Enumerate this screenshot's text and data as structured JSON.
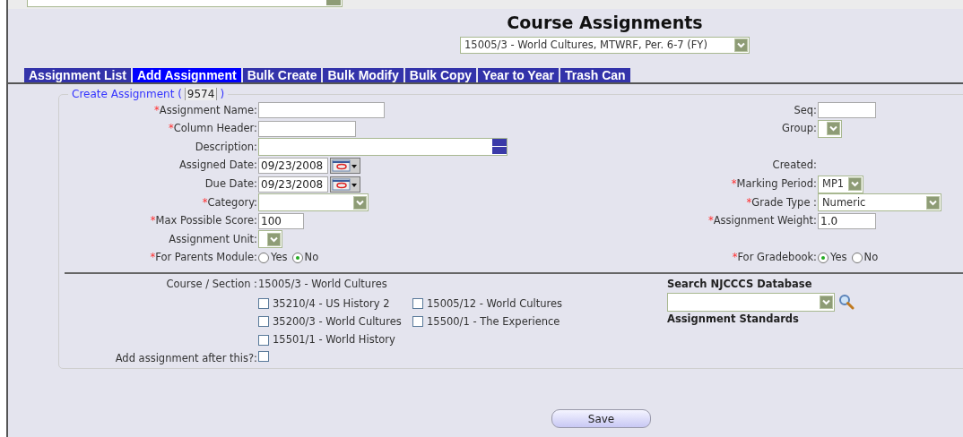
{
  "page_title": "Course Assignments",
  "section_select": {
    "value": "15005/3 - World Cultures, MTWRF, Per. 6-7 (FY)"
  },
  "tabs": [
    {
      "label": "Assignment List",
      "selected": false
    },
    {
      "label": "Add Assignment",
      "selected": true
    },
    {
      "label": "Bulk Create",
      "selected": false
    },
    {
      "label": "Bulk Modify",
      "selected": false
    },
    {
      "label": "Bulk Copy",
      "selected": false
    },
    {
      "label": "Year to Year",
      "selected": false
    },
    {
      "label": "Trash Can",
      "selected": false
    }
  ],
  "form": {
    "legend": "Create Assignment (",
    "id_value": "9574",
    "legend_end": ")",
    "rows": [
      {
        "left": {
          "kind": "text",
          "mark": "*",
          "label": "Assignment Name:"
        },
        "right": {
          "kind": "text",
          "label": "Seq:"
        }
      },
      {
        "left": {
          "kind": "text",
          "mark": "*",
          "label": "Column Header:"
        },
        "right": {
          "kind": "select",
          "label": "Group:"
        }
      },
      {
        "left": {
          "kind": "textarea",
          "label": "Description:"
        }
      },
      {
        "left": {
          "kind": "date",
          "label": "Assigned Date:",
          "value": "09/23/2008"
        },
        "right": {
          "kind": "plain",
          "label": "Created:"
        }
      },
      {
        "left": {
          "kind": "date",
          "label": "Due Date:",
          "value": "09/23/2008"
        },
        "right": {
          "kind": "select",
          "mark": "*",
          "label": "Marking Period:",
          "value": "MP1"
        }
      },
      {
        "left": {
          "kind": "select",
          "mark": "*",
          "label": "Category:"
        },
        "right": {
          "kind": "select",
          "mark": "*",
          "label": "Grade Type :",
          "value": "Numeric"
        }
      },
      {
        "left": {
          "kind": "text",
          "mark": "*",
          "label": "Max Possible Score:",
          "value": "100"
        },
        "right": {
          "kind": "text",
          "mark": "*",
          "label": "Assignment Weight:",
          "value": "1.0"
        }
      },
      {
        "left": {
          "kind": "select",
          "label": "Assignment Unit:"
        }
      },
      {
        "left": {
          "kind": "radio",
          "mark": "*",
          "label": "For Parents Module:",
          "options": [
            {
              "label": "Yes",
              "selected": false
            },
            {
              "label": "No",
              "selected": true
            }
          ]
        },
        "right": {
          "kind": "radio",
          "mark": "*",
          "label": "For Gradebook:",
          "options": [
            {
              "label": "Yes",
              "selected": true
            },
            {
              "label": "No",
              "selected": false
            }
          ]
        }
      }
    ]
  },
  "course_section": {
    "label": "Course / Section :",
    "value": "15005/3 - World Cultures",
    "sections": [
      {
        "label": "35210/4 - US History 2",
        "checked": false
      },
      {
        "label": "15005/12 - World Cultures",
        "checked": false
      },
      {
        "label": "35200/3 - World Cultures",
        "checked": false
      },
      {
        "label": "15500/1 - The Experience",
        "checked": false
      },
      {
        "label": "15501/1 - World History",
        "checked": false
      }
    ]
  },
  "add_after": {
    "label": "Add assignment after this?:",
    "checked": false
  },
  "standards": {
    "search_label": "Search NJCCCS Database",
    "heading": "Assignment Standards"
  },
  "save_button": "Save"
}
